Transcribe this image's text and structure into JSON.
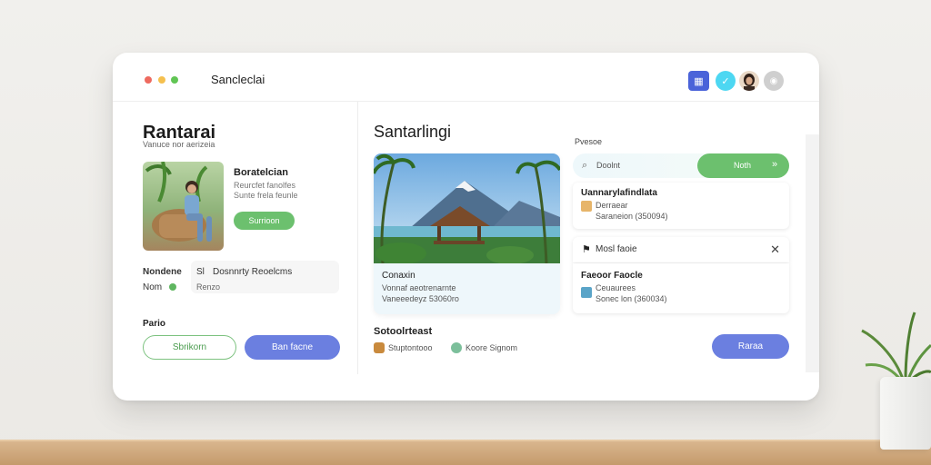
{
  "window": {
    "title": "Sancleclai",
    "traffic_lights": [
      "#ee6a5f",
      "#f5c04f",
      "#61c554"
    ],
    "header_icons": [
      {
        "name": "calendar-icon",
        "glyph": "▦",
        "color": "#4a63d9"
      },
      {
        "name": "check-icon",
        "glyph": "✓",
        "color": "#4dd7f2"
      },
      {
        "name": "avatar",
        "glyph": "",
        "color": "#3b2a20"
      },
      {
        "name": "user-icon",
        "glyph": "👤",
        "color": "#cfcfcf"
      }
    ]
  },
  "left": {
    "heading": "Rantarai",
    "subheading": "Vanuce nor aerizeia",
    "profile": {
      "name": "Boratelcian",
      "line1": "Reurcfet fanolfes",
      "line2": "Sunte frela feunle",
      "button": "Surrioon"
    },
    "info": {
      "label1": "Nondene",
      "label2": "Nom",
      "value1": "Dosnnrty Reoelcms",
      "value2": "Renzo",
      "prefix1": "Sl"
    },
    "bottom_label": "Pario",
    "btn_outline": "Sbrikorn",
    "btn_primary": "Ban facne"
  },
  "middle": {
    "heading": "Santarlingi",
    "card": {
      "title": "Conaxin",
      "line1": "Vonnaf aeotrenarnte",
      "line2": "Vaneeedeyz 53060ro"
    },
    "section": "Sotoolrteast",
    "chip1": "Stuptontooo",
    "chip2": "Koore Signom"
  },
  "right": {
    "label": "Pvesoe",
    "search_text": "Doolnt",
    "search_btn": "Noth",
    "search_btn_icon": "»",
    "card1": {
      "title": "Uannarylafindlata",
      "line1": "Derraear",
      "line2": "Saraneion (350094)"
    },
    "card2_head": "Mosl faoie",
    "card2": {
      "title": "Faeoor Faocle",
      "line1": "Ceuaurees",
      "line2": "Sonec lon (360034)"
    },
    "btn": "Raraa"
  },
  "colors": {
    "accent_blue": "#6b7fe0",
    "accent_green": "#6cc06e"
  }
}
